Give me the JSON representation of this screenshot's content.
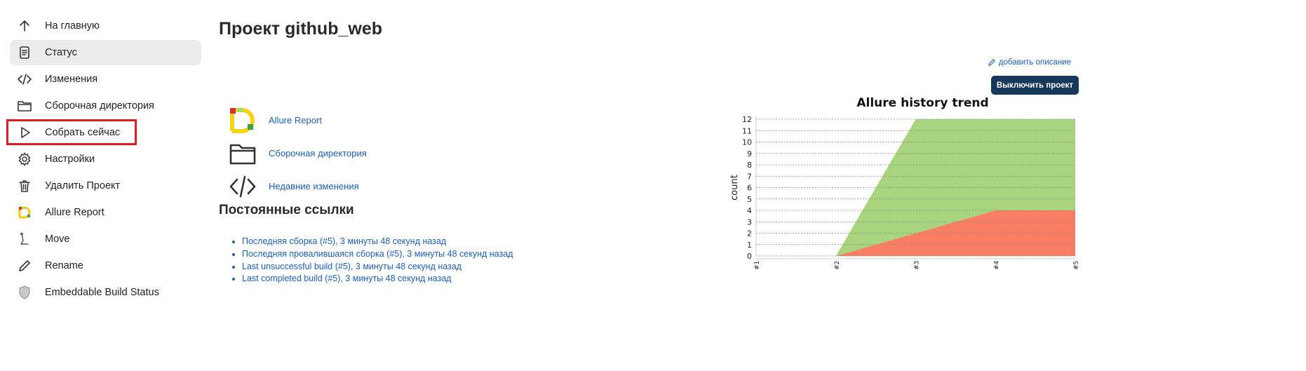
{
  "sidebar": {
    "items": [
      {
        "label": "На главную",
        "icon": "arrow-up-icon"
      },
      {
        "label": "Статус",
        "icon": "document-icon",
        "active": true
      },
      {
        "label": "Изменения",
        "icon": "code-icon"
      },
      {
        "label": "Сборочная директория",
        "icon": "folder-icon"
      },
      {
        "label": "Собрать сейчас",
        "icon": "play-icon"
      },
      {
        "label": "Настройки",
        "icon": "gear-icon"
      },
      {
        "label": "Удалить Проект",
        "icon": "trash-icon"
      },
      {
        "label": "Allure Report",
        "icon": "allure-logo-icon"
      },
      {
        "label": "Move",
        "icon": "move-icon"
      },
      {
        "label": "Rename",
        "icon": "pencil-icon"
      },
      {
        "label": "Embeddable Build Status",
        "icon": "shield-icon"
      }
    ]
  },
  "main": {
    "title": "Проект github_web",
    "add_description": "добавить описание",
    "disable_button": "Выключить проект",
    "links": [
      {
        "label": "Allure Report",
        "icon": "allure-logo-icon"
      },
      {
        "label": "Сборочная директория",
        "icon": "folder-icon"
      },
      {
        "label": "Недавние изменения",
        "icon": "code-icon"
      }
    ],
    "permalinks_title": "Постоянные ссылки",
    "permalinks": [
      "Последняя сборка (#5), 3 минуты 48 секунд назад",
      "Последняя провалившаяся сборка (#5), 3 минуты 48 секунд назад",
      "Last unsuccessful build (#5), 3 минуты 48 секунд назад",
      "Last completed build (#5), 3 минуты 48 секунд назад"
    ]
  },
  "colors": {
    "accent": "#1d5fb8",
    "button": "#16385b",
    "highlight": "#e01b24",
    "passed": "#a7d47d",
    "failed": "#fa7d64"
  },
  "chart_data": {
    "type": "area",
    "title": "Allure history trend",
    "ylabel": "count",
    "xlabel": "",
    "x": [
      "#1",
      "#2",
      "#3",
      "#4",
      "#5"
    ],
    "ylim": [
      0,
      12
    ],
    "yticks": [
      0,
      1,
      2,
      3,
      4,
      5,
      6,
      7,
      8,
      9,
      10,
      11,
      12
    ],
    "grid": true,
    "stacked": true,
    "series": [
      {
        "values": [
          null,
          0,
          2,
          4,
          4
        ],
        "color": "#fa7d64"
      },
      {
        "values": [
          null,
          0,
          10,
          8,
          8
        ],
        "color": "#a7d47d"
      }
    ]
  }
}
